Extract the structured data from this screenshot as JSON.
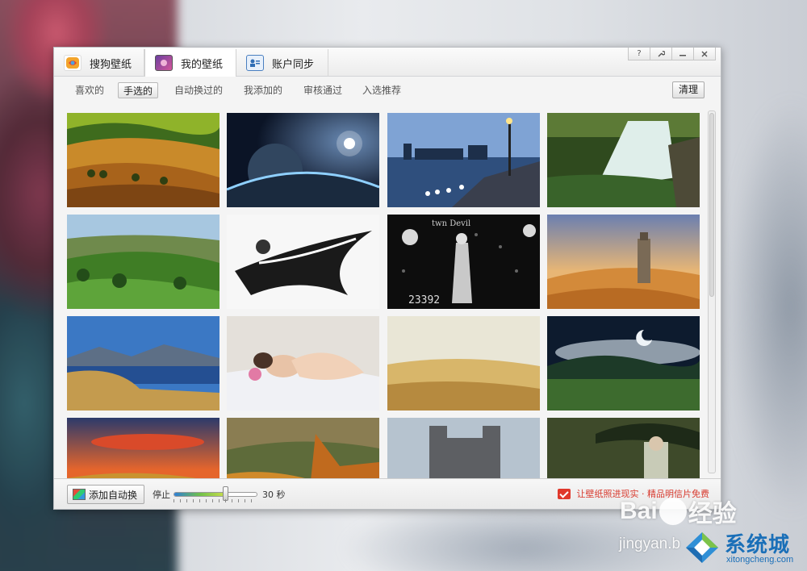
{
  "window": {
    "tabs": [
      {
        "label": "搜狗壁纸",
        "icon": "sogou-logo-icon"
      },
      {
        "label": "我的壁纸",
        "icon": "my-wallpaper-icon"
      },
      {
        "label": "账户同步",
        "icon": "account-sync-icon"
      }
    ],
    "controls": {
      "help": "?",
      "settings": "wrench-icon",
      "minimize": "minimize-icon",
      "close": "close-icon"
    }
  },
  "filters": {
    "items": [
      "喜欢的",
      "手选的",
      "自动换过的",
      "我添加的",
      "审核通过",
      "入选推荐"
    ],
    "selected": "手选的",
    "clear_label": "清理"
  },
  "wallpapers": [
    {
      "name": "golden-hills"
    },
    {
      "name": "planet-space"
    },
    {
      "name": "city-night-river"
    },
    {
      "name": "waterfall"
    },
    {
      "name": "green-valley"
    },
    {
      "name": "bleach-anime"
    },
    {
      "name": "dark-anime-girl",
      "overlay_text": "23392"
    },
    {
      "name": "desert-tower"
    },
    {
      "name": "blue-lake-mountains"
    },
    {
      "name": "sleeping-girl"
    },
    {
      "name": "wheat-field"
    },
    {
      "name": "moon-grassland"
    },
    {
      "name": "sunset-road"
    },
    {
      "name": "autumn-valley"
    },
    {
      "name": "castle"
    },
    {
      "name": "umbrella-girl"
    }
  ],
  "bottom": {
    "add_auto_label": "添加自动换",
    "stop_label": "停止",
    "interval_label": "30 秒",
    "promo_text": "让壁纸照进现实 · 精品明信片免费",
    "slider_value": 0.62
  },
  "watermarks": {
    "baidu": "Bai",
    "baidu_suffix": "经验",
    "jingyan": "jingyan.b",
    "xitong": "系统城",
    "domain": "xitongcheng.com"
  },
  "colors": {
    "accent": "#d83a2e",
    "watermark_blue": "#1a6fb8"
  }
}
